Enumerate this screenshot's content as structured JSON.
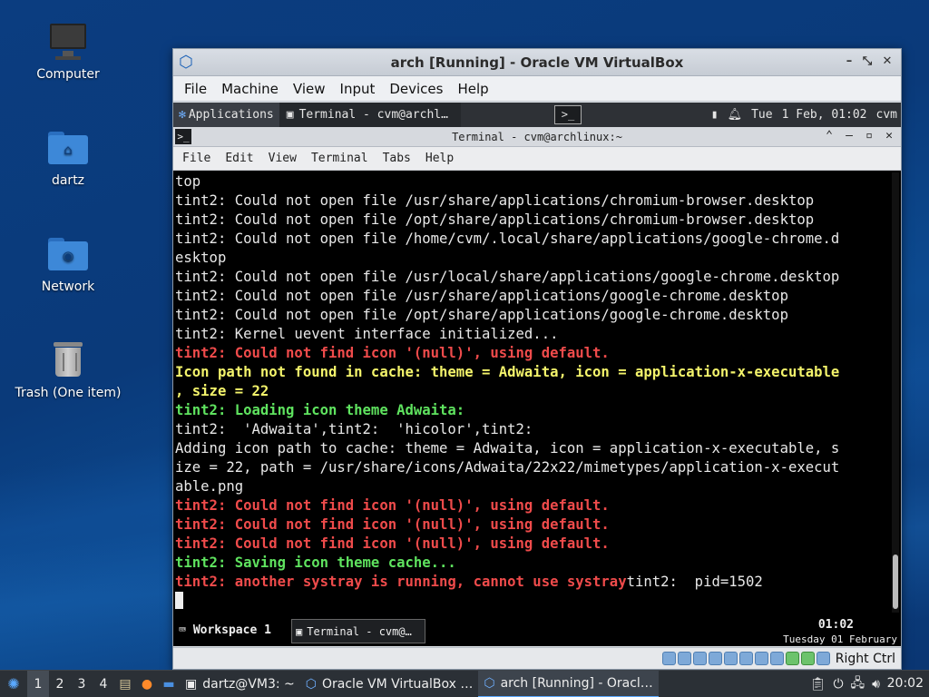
{
  "desktop": {
    "icons": [
      {
        "label": "Computer",
        "icon": "computer-icon"
      },
      {
        "label": "dartz",
        "icon": "home-folder-icon"
      },
      {
        "label": "Network",
        "icon": "network-folder-icon"
      },
      {
        "label": "Trash (One item)",
        "icon": "trash-icon"
      }
    ]
  },
  "vbox": {
    "title": "arch [Running] - Oracle VM VirtualBox",
    "menu": [
      "File",
      "Machine",
      "View",
      "Input",
      "Devices",
      "Help"
    ],
    "status_hostkey": "Right Ctrl"
  },
  "guest_panel": {
    "apps_label": "Applications",
    "task_label": "Terminal - cvm@archl…",
    "day": "Tue",
    "datetime": "1 Feb, 01:02",
    "user": "cvm"
  },
  "terminal": {
    "title": "Terminal - cvm@archlinux:~",
    "menu": [
      "File",
      "Edit",
      "View",
      "Terminal",
      "Tabs",
      "Help"
    ],
    "lines": [
      {
        "text": "top",
        "color": "white"
      },
      {
        "text": "tint2: Could not open file /usr/share/applications/chromium-browser.desktop",
        "color": "white"
      },
      {
        "text": "tint2: Could not open file /opt/share/applications/chromium-browser.desktop",
        "color": "white"
      },
      {
        "text": "tint2: Could not open file /home/cvm/.local/share/applications/google-chrome.d",
        "color": "white"
      },
      {
        "text": "esktop",
        "color": "white"
      },
      {
        "text": "tint2: Could not open file /usr/local/share/applications/google-chrome.desktop",
        "color": "white"
      },
      {
        "text": "tint2: Could not open file /usr/share/applications/google-chrome.desktop",
        "color": "white"
      },
      {
        "text": "tint2: Could not open file /opt/share/applications/google-chrome.desktop",
        "color": "white"
      },
      {
        "text": "tint2: Kernel uevent interface initialized...",
        "color": "white"
      },
      {
        "text": "tint2: Could not find icon '(null)', using default.",
        "color": "red"
      },
      {
        "text": "Icon path not found in cache: theme = Adwaita, icon = application-x-executable",
        "color": "yellow"
      },
      {
        "text": ", size = 22",
        "color": "yellow"
      },
      {
        "text": "tint2: Loading icon theme Adwaita:",
        "color": "green"
      },
      {
        "text": "tint2:  'Adwaita',tint2:  'hicolor',tint2:",
        "color": "white"
      },
      {
        "text": "Adding icon path to cache: theme = Adwaita, icon = application-x-executable, s",
        "color": "white"
      },
      {
        "text": "ize = 22, path = /usr/share/icons/Adwaita/22x22/mimetypes/application-x-execut",
        "color": "white"
      },
      {
        "text": "able.png",
        "color": "white"
      },
      {
        "text": "tint2: Could not find icon '(null)', using default.",
        "color": "red"
      },
      {
        "text": "tint2: Could not find icon '(null)', using default.",
        "color": "red"
      },
      {
        "text": "tint2: Could not find icon '(null)', using default.",
        "color": "red"
      },
      {
        "text": "tint2: Saving icon theme cache...",
        "color": "green"
      }
    ],
    "last_line_red": "tint2: another systray is running, cannot use systray",
    "last_line_white": "tint2:  pid=1502"
  },
  "guest_bottom": {
    "workspace": "Workspace 1",
    "task": "Terminal - cvm@…",
    "time": "01:02",
    "date": "Tuesday 01 February"
  },
  "host_taskbar": {
    "workspaces": [
      "1",
      "2",
      "3",
      "4"
    ],
    "tasks": [
      {
        "label": "dartz@VM3: ~",
        "icon": "terminal-icon"
      },
      {
        "label": "Oracle VM VirtualBox …",
        "icon": "virtualbox-icon"
      },
      {
        "label": "arch [Running] - Oracl…",
        "icon": "virtualbox-icon"
      }
    ],
    "clock": "20:02"
  }
}
